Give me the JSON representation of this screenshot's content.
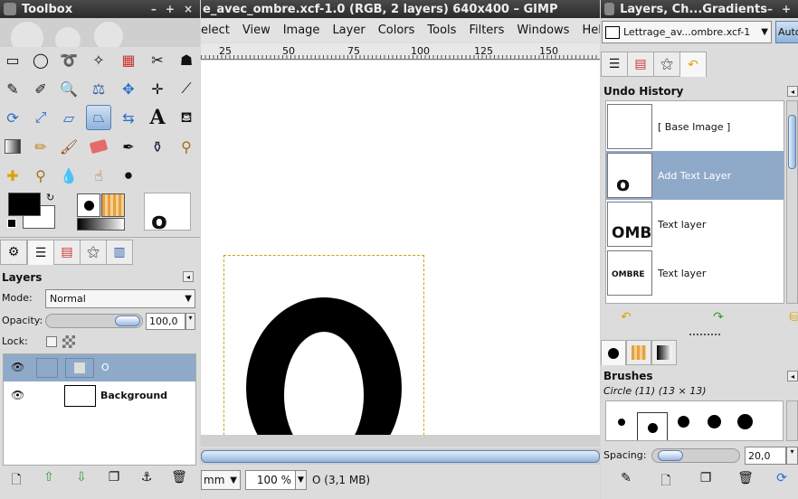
{
  "toolbox": {
    "title": "Toolbox",
    "layers_panel": {
      "title": "Layers",
      "mode_label": "Mode:",
      "mode_value": "Normal",
      "opacity_label": "Opacity:",
      "opacity_value": "100,0",
      "lock_label": "Lock:",
      "layers": [
        {
          "name": "O",
          "selected": true
        },
        {
          "name": "Background",
          "selected": false
        }
      ]
    },
    "preview_glyph": "o"
  },
  "image_window": {
    "title": "e_avec_ombre.xcf-1.0 (RGB, 2 layers) 640x400 – GIMP",
    "menu": [
      "elect",
      "View",
      "Image",
      "Layer",
      "Colors",
      "Tools",
      "Filters",
      "Windows",
      "Help"
    ],
    "ruler_labels": [
      "25",
      "50",
      "75",
      "100",
      "125",
      "150"
    ],
    "canvas_glyph": "o",
    "status": {
      "unit": "mm",
      "zoom": "100 %",
      "info": "O (3,1 MB)"
    }
  },
  "dock": {
    "title": "Layers, Ch...Gradients",
    "image_select": "Lettrage_av...ombre.xcf-1",
    "auto_label": "Auto",
    "undo_history": {
      "title": "Undo History",
      "items": [
        {
          "label": "[ Base Image ]",
          "thumb": "",
          "selected": false
        },
        {
          "label": "Add Text Layer",
          "thumb": "o",
          "selected": true
        },
        {
          "label": "Text layer",
          "thumb": "OMB",
          "selected": false
        },
        {
          "label": "Text layer",
          "thumb": "OMBRE",
          "selected": false
        }
      ]
    },
    "brushes": {
      "title": "Brushes",
      "current": "Circle (11) (13 × 13)",
      "spacing_label": "Spacing:",
      "spacing_value": "20,0"
    }
  },
  "colors": {
    "accent": "#8fa9c9",
    "titlebar": "#333333",
    "selection": "#8fa9c9"
  }
}
